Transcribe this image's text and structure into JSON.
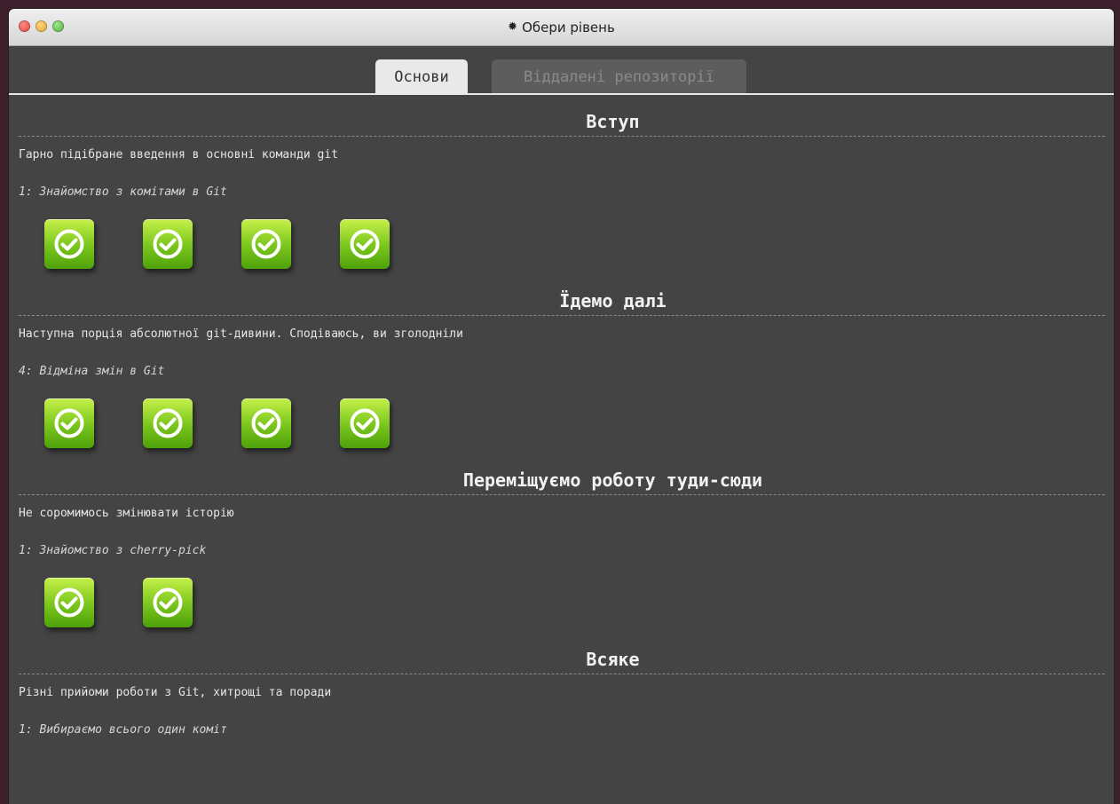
{
  "window": {
    "title": "Обери рівень",
    "title_icon": "gear-icon"
  },
  "tabs": [
    {
      "label": "Основи",
      "active": true
    },
    {
      "label": "Віддалені репозиторії",
      "active": false
    }
  ],
  "sections": [
    {
      "title": "Вступ",
      "description": "Гарно підібране введення в основні команди git",
      "level": "1: Знайомство з комітами в Git",
      "levels_completed": 4
    },
    {
      "title": "Їдемо далі",
      "description": "Наступна порція абсолютної git-дивини. Сподіваюсь, ви зголодніли",
      "level": "4: Відміна змін в Git",
      "levels_completed": 4
    },
    {
      "title": "Переміщуємо роботу туди-сюди",
      "description": "Не соромимось змінювати історію",
      "level": "1: Знайомство з cherry-pick",
      "levels_completed": 2
    },
    {
      "title": "Всяке",
      "description": "Різні прийоми роботи з Git, хитрощі та поради",
      "level": "1: Вибираємо всього один коміт",
      "levels_completed": 0
    }
  ],
  "colors": {
    "level_complete_top": "#c6f04b",
    "level_complete_bottom": "#4ea10a",
    "background": "#444444"
  }
}
